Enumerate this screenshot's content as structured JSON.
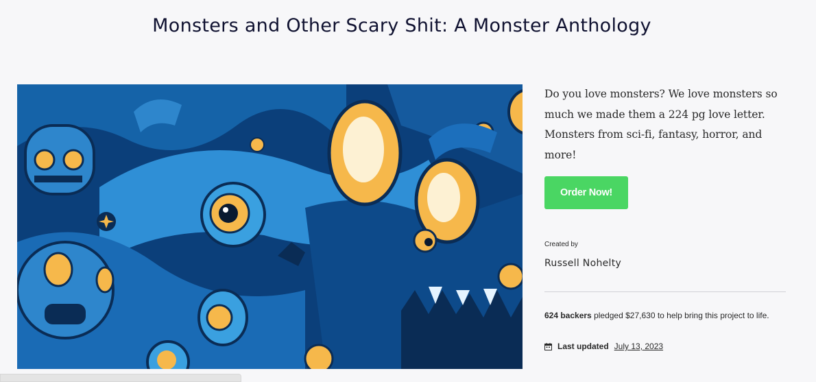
{
  "project": {
    "title": "Monsters and Other Scary Shit: A Monster Anthology",
    "blurb": "Do you love monsters? We love monsters so much we made them a 224 pg love letter. Monsters from sci-fi, fantasy, horror, and more!",
    "order_button": "Order Now!",
    "created_by_label": "Created by",
    "creator_name": "Russell Nohelty",
    "backers": "624 backers",
    "pledged_text": " pledged $27,630 to help bring this project to life.",
    "last_updated_label": "Last updated",
    "last_updated_date": "July 13, 2023"
  },
  "status_bar": {
    "text": ""
  },
  "colors": {
    "accent_green": "#4ad663",
    "title": "#0f1130",
    "art_dark_blue": "#0b3f7a",
    "art_light_blue": "#3aa0e0",
    "art_yellow": "#f6b84b"
  },
  "icons": {
    "calendar": "calendar-icon"
  }
}
